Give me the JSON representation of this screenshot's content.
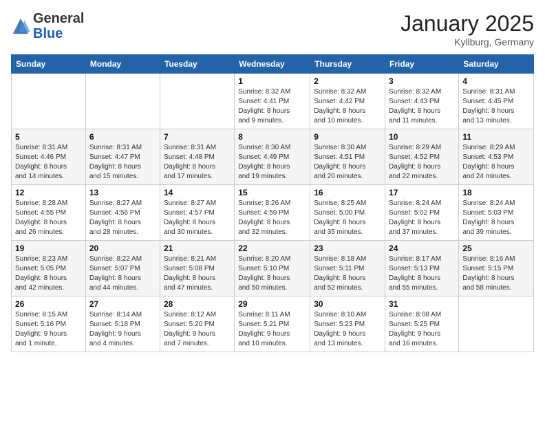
{
  "logo": {
    "general": "General",
    "blue": "Blue"
  },
  "header": {
    "month": "January 2025",
    "location": "Kyllburg, Germany"
  },
  "weekdays": [
    "Sunday",
    "Monday",
    "Tuesday",
    "Wednesday",
    "Thursday",
    "Friday",
    "Saturday"
  ],
  "weeks": [
    [
      {
        "day": "",
        "info": ""
      },
      {
        "day": "",
        "info": ""
      },
      {
        "day": "",
        "info": ""
      },
      {
        "day": "1",
        "info": "Sunrise: 8:32 AM\nSunset: 4:41 PM\nDaylight: 8 hours\nand 9 minutes."
      },
      {
        "day": "2",
        "info": "Sunrise: 8:32 AM\nSunset: 4:42 PM\nDaylight: 8 hours\nand 10 minutes."
      },
      {
        "day": "3",
        "info": "Sunrise: 8:32 AM\nSunset: 4:43 PM\nDaylight: 8 hours\nand 11 minutes."
      },
      {
        "day": "4",
        "info": "Sunrise: 8:31 AM\nSunset: 4:45 PM\nDaylight: 8 hours\nand 13 minutes."
      }
    ],
    [
      {
        "day": "5",
        "info": "Sunrise: 8:31 AM\nSunset: 4:46 PM\nDaylight: 8 hours\nand 14 minutes."
      },
      {
        "day": "6",
        "info": "Sunrise: 8:31 AM\nSunset: 4:47 PM\nDaylight: 8 hours\nand 15 minutes."
      },
      {
        "day": "7",
        "info": "Sunrise: 8:31 AM\nSunset: 4:48 PM\nDaylight: 8 hours\nand 17 minutes."
      },
      {
        "day": "8",
        "info": "Sunrise: 8:30 AM\nSunset: 4:49 PM\nDaylight: 8 hours\nand 19 minutes."
      },
      {
        "day": "9",
        "info": "Sunrise: 8:30 AM\nSunset: 4:51 PM\nDaylight: 8 hours\nand 20 minutes."
      },
      {
        "day": "10",
        "info": "Sunrise: 8:29 AM\nSunset: 4:52 PM\nDaylight: 8 hours\nand 22 minutes."
      },
      {
        "day": "11",
        "info": "Sunrise: 8:29 AM\nSunset: 4:53 PM\nDaylight: 8 hours\nand 24 minutes."
      }
    ],
    [
      {
        "day": "12",
        "info": "Sunrise: 8:28 AM\nSunset: 4:55 PM\nDaylight: 8 hours\nand 26 minutes."
      },
      {
        "day": "13",
        "info": "Sunrise: 8:27 AM\nSunset: 4:56 PM\nDaylight: 8 hours\nand 28 minutes."
      },
      {
        "day": "14",
        "info": "Sunrise: 8:27 AM\nSunset: 4:57 PM\nDaylight: 8 hours\nand 30 minutes."
      },
      {
        "day": "15",
        "info": "Sunrise: 8:26 AM\nSunset: 4:59 PM\nDaylight: 8 hours\nand 32 minutes."
      },
      {
        "day": "16",
        "info": "Sunrise: 8:25 AM\nSunset: 5:00 PM\nDaylight: 8 hours\nand 35 minutes."
      },
      {
        "day": "17",
        "info": "Sunrise: 8:24 AM\nSunset: 5:02 PM\nDaylight: 8 hours\nand 37 minutes."
      },
      {
        "day": "18",
        "info": "Sunrise: 8:24 AM\nSunset: 5:03 PM\nDaylight: 8 hours\nand 39 minutes."
      }
    ],
    [
      {
        "day": "19",
        "info": "Sunrise: 8:23 AM\nSunset: 5:05 PM\nDaylight: 8 hours\nand 42 minutes."
      },
      {
        "day": "20",
        "info": "Sunrise: 8:22 AM\nSunset: 5:07 PM\nDaylight: 8 hours\nand 44 minutes."
      },
      {
        "day": "21",
        "info": "Sunrise: 8:21 AM\nSunset: 5:08 PM\nDaylight: 8 hours\nand 47 minutes."
      },
      {
        "day": "22",
        "info": "Sunrise: 8:20 AM\nSunset: 5:10 PM\nDaylight: 8 hours\nand 50 minutes."
      },
      {
        "day": "23",
        "info": "Sunrise: 8:18 AM\nSunset: 5:11 PM\nDaylight: 8 hours\nand 52 minutes."
      },
      {
        "day": "24",
        "info": "Sunrise: 8:17 AM\nSunset: 5:13 PM\nDaylight: 8 hours\nand 55 minutes."
      },
      {
        "day": "25",
        "info": "Sunrise: 8:16 AM\nSunset: 5:15 PM\nDaylight: 8 hours\nand 58 minutes."
      }
    ],
    [
      {
        "day": "26",
        "info": "Sunrise: 8:15 AM\nSunset: 5:16 PM\nDaylight: 9 hours\nand 1 minute."
      },
      {
        "day": "27",
        "info": "Sunrise: 8:14 AM\nSunset: 5:18 PM\nDaylight: 9 hours\nand 4 minutes."
      },
      {
        "day": "28",
        "info": "Sunrise: 8:12 AM\nSunset: 5:20 PM\nDaylight: 9 hours\nand 7 minutes."
      },
      {
        "day": "29",
        "info": "Sunrise: 8:11 AM\nSunset: 5:21 PM\nDaylight: 9 hours\nand 10 minutes."
      },
      {
        "day": "30",
        "info": "Sunrise: 8:10 AM\nSunset: 5:23 PM\nDaylight: 9 hours\nand 13 minutes."
      },
      {
        "day": "31",
        "info": "Sunrise: 8:08 AM\nSunset: 5:25 PM\nDaylight: 9 hours\nand 16 minutes."
      },
      {
        "day": "",
        "info": ""
      }
    ]
  ]
}
